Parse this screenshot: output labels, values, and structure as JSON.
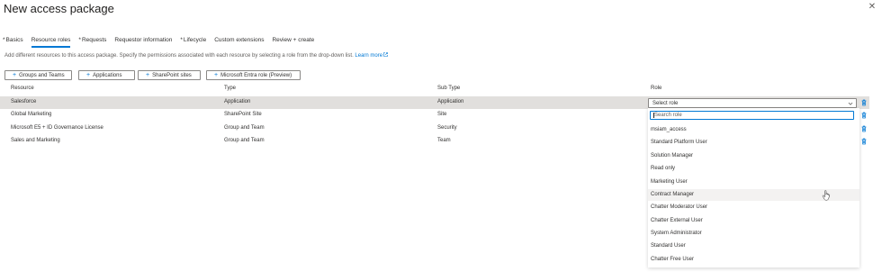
{
  "header": {
    "title": "New access package",
    "more": "···",
    "close": "✕"
  },
  "tabs": [
    {
      "label": "Basics",
      "required": "*"
    },
    {
      "label": "Resource roles",
      "required": ""
    },
    {
      "label": "Requests",
      "required": "*"
    },
    {
      "label": "Requestor information",
      "required": ""
    },
    {
      "label": "Lifecycle",
      "required": "*"
    },
    {
      "label": "Custom extensions",
      "required": ""
    },
    {
      "label": "Review + create",
      "required": ""
    }
  ],
  "description": {
    "text": "Add different resources to this access package. Specify the permissions associated with each resource by selecting a role from the drop-down list.",
    "link": "Learn more"
  },
  "toolbar": {
    "groups_teams": "Groups and Teams",
    "applications": "Applications",
    "sharepoint": "SharePoint sites",
    "entra_role": "Microsoft Entra role (Preview)"
  },
  "table": {
    "headers": {
      "resource": "Resource",
      "type": "Type",
      "subtype": "Sub Type",
      "role": "Role"
    },
    "rows": [
      {
        "resource": "Salesforce",
        "type": "Application",
        "subtype": "Application"
      },
      {
        "resource": "Global Marketing",
        "type": "SharePoint Site",
        "subtype": "Site"
      },
      {
        "resource": "Microsoft E5 + ID Governance License",
        "type": "Group and Team",
        "subtype": "Security"
      },
      {
        "resource": "Sales and Marketing",
        "type": "Group and Team",
        "subtype": "Team"
      }
    ]
  },
  "role_select": {
    "value": "Select role",
    "search_placeholder": "Search role",
    "options": [
      "msiam_access",
      "Standard Platform User",
      "Solution Manager",
      "Read only",
      "Marketing User",
      "Contract Manager",
      "Chatter Moderator User",
      "Chatter External User",
      "System Administrator",
      "Standard User",
      "Chatter Free User"
    ],
    "hovered": "Contract Manager"
  },
  "colors": {
    "accent": "#0078d4",
    "selected_row": "#e1dfdd",
    "hover_option": "#f3f2f1",
    "delete_icon": "#0078d4"
  }
}
